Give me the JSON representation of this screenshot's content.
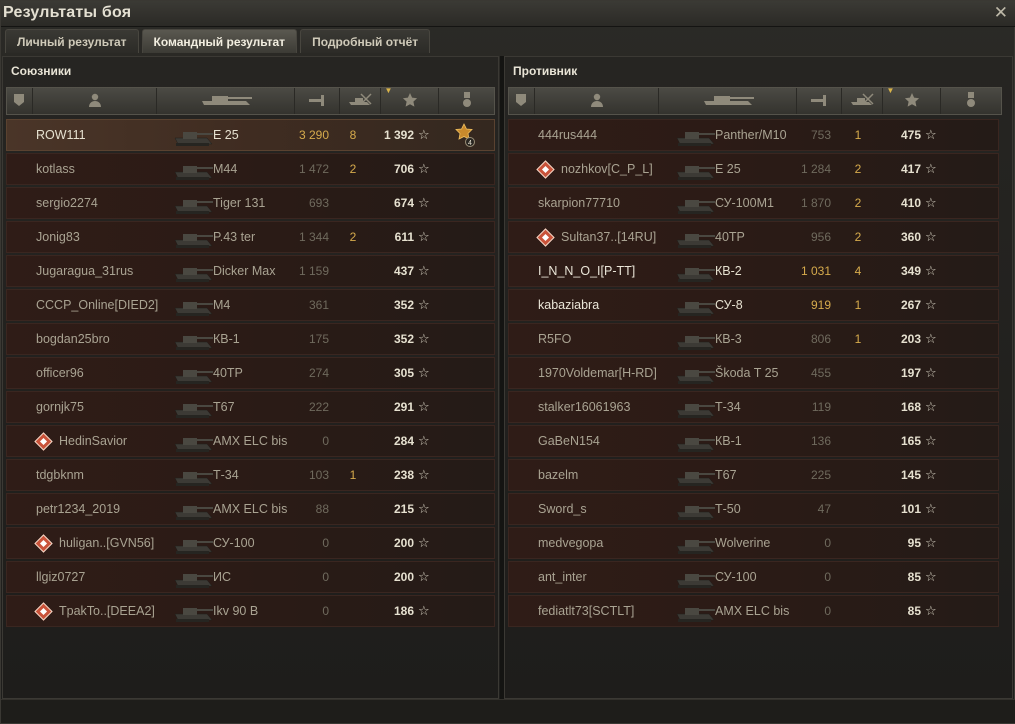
{
  "window": {
    "title": "Результаты боя",
    "close_icon": "close-icon"
  },
  "tabs": [
    {
      "label": "Личный результат",
      "active": false
    },
    {
      "label": "Командный результат",
      "active": true
    },
    {
      "label": "Подробный отчёт",
      "active": false
    }
  ],
  "allies": {
    "title": "Союзники",
    "header_icons": [
      "platoon-icon",
      "player-icon",
      "tank-icon",
      "damage-icon",
      "frags-icon",
      "xp-star-icon",
      "medal-icon"
    ],
    "rows": [
      {
        "name": "ROW111",
        "vehicle": "E 25",
        "damage": "3 290",
        "frags": "8",
        "xp": "1 392",
        "badge": false,
        "me": true,
        "medal": true,
        "dmg_gold": true
      },
      {
        "name": "kotlass",
        "vehicle": "M44",
        "damage": "1 472",
        "frags": "2",
        "xp": "706",
        "badge": false
      },
      {
        "name": "sergio2274",
        "vehicle": "Tiger 131",
        "damage": "693",
        "frags": "",
        "xp": "674",
        "badge": false
      },
      {
        "name": "Jonig83",
        "vehicle": "P.43 ter",
        "damage": "1 344",
        "frags": "2",
        "xp": "611",
        "badge": false
      },
      {
        "name": "Jugaragua_31rus",
        "vehicle": "Dicker Max",
        "damage": "1 159",
        "frags": "",
        "xp": "437",
        "badge": false
      },
      {
        "name": "CCCP_Online[DIED2]",
        "vehicle": "M4",
        "damage": "361",
        "frags": "",
        "xp": "352",
        "badge": false
      },
      {
        "name": "bogdan25bro",
        "vehicle": "КВ-1",
        "damage": "175",
        "frags": "",
        "xp": "352",
        "badge": false
      },
      {
        "name": "officer96",
        "vehicle": "40TP",
        "damage": "274",
        "frags": "",
        "xp": "305",
        "badge": false
      },
      {
        "name": "gornjk75",
        "vehicle": "T67",
        "damage": "222",
        "frags": "",
        "xp": "291",
        "badge": false
      },
      {
        "name": "HedinSavior",
        "vehicle": "AMX ELC bis",
        "damage": "0",
        "frags": "",
        "xp": "284",
        "badge": true
      },
      {
        "name": "tdgbknm",
        "vehicle": "Т-34",
        "damage": "103",
        "frags": "1",
        "xp": "238",
        "badge": false
      },
      {
        "name": "petr1234_2019",
        "vehicle": "AMX ELC bis",
        "damage": "88",
        "frags": "",
        "xp": "215",
        "badge": false
      },
      {
        "name": "huligan..[GVN56]",
        "vehicle": "СУ-100",
        "damage": "0",
        "frags": "",
        "xp": "200",
        "badge": true
      },
      {
        "name": "llgiz0727",
        "vehicle": "ИС",
        "damage": "0",
        "frags": "",
        "xp": "200",
        "badge": false
      },
      {
        "name": "TpakTo..[DEEA2]",
        "vehicle": "Ikv 90 B",
        "damage": "0",
        "frags": "",
        "xp": "186",
        "badge": true
      }
    ]
  },
  "enemies": {
    "title": "Противник",
    "header_icons": [
      "platoon-icon",
      "player-icon",
      "tank-icon",
      "damage-icon",
      "frags-icon",
      "xp-star-icon",
      "medal-icon"
    ],
    "rows": [
      {
        "name": "444rus444",
        "vehicle": "Panther/M10",
        "damage": "753",
        "frags": "1",
        "xp": "475",
        "badge": false
      },
      {
        "name": "nozhkov[C_P_L]",
        "vehicle": "E 25",
        "damage": "1 284",
        "frags": "2",
        "xp": "417",
        "badge": true
      },
      {
        "name": "skarpion77710",
        "vehicle": "СУ-100М1",
        "damage": "1 870",
        "frags": "2",
        "xp": "410",
        "badge": false
      },
      {
        "name": "Sultan37..[14RU]",
        "vehicle": "40TP",
        "damage": "956",
        "frags": "2",
        "xp": "360",
        "badge": true
      },
      {
        "name": "I_N_N_O_I[P-TT]",
        "vehicle": "КВ-2",
        "damage": "1 031",
        "frags": "4",
        "xp": "349",
        "badge": false,
        "bright": true,
        "dmg_gold": true
      },
      {
        "name": "kabaziabra",
        "vehicle": "СУ-8",
        "damage": "919",
        "frags": "1",
        "xp": "267",
        "badge": false,
        "bright": true,
        "dmg_gold": true
      },
      {
        "name": "R5FO",
        "vehicle": "КВ-3",
        "damage": "806",
        "frags": "1",
        "xp": "203",
        "badge": false
      },
      {
        "name": "1970Voldemar[H-RD]",
        "vehicle": "Škoda T 25",
        "damage": "455",
        "frags": "",
        "xp": "197",
        "badge": false
      },
      {
        "name": "stalker16061963",
        "vehicle": "Т-34",
        "damage": "119",
        "frags": "",
        "xp": "168",
        "badge": false
      },
      {
        "name": "GaBeN154",
        "vehicle": "КВ-1",
        "damage": "136",
        "frags": "",
        "xp": "165",
        "badge": false
      },
      {
        "name": "bazelm",
        "vehicle": "T67",
        "damage": "225",
        "frags": "",
        "xp": "145",
        "badge": false
      },
      {
        "name": "Sword_s",
        "vehicle": "Т-50",
        "damage": "47",
        "frags": "",
        "xp": "101",
        "badge": false
      },
      {
        "name": "medvegopa",
        "vehicle": "Wolverine",
        "damage": "0",
        "frags": "",
        "xp": "95",
        "badge": false
      },
      {
        "name": "ant_inter",
        "vehicle": "СУ-100",
        "damage": "0",
        "frags": "",
        "xp": "85",
        "badge": false
      },
      {
        "name": "fediatlt73[SCTLT]",
        "vehicle": "AMX ELC bis",
        "damage": "0",
        "frags": "",
        "xp": "85",
        "badge": false
      }
    ]
  },
  "colors": {
    "accent_gold": "#d6ab4c",
    "row_bg": "#2c1b16",
    "text": "#a9a392",
    "highlight": "#e6e1d0"
  }
}
